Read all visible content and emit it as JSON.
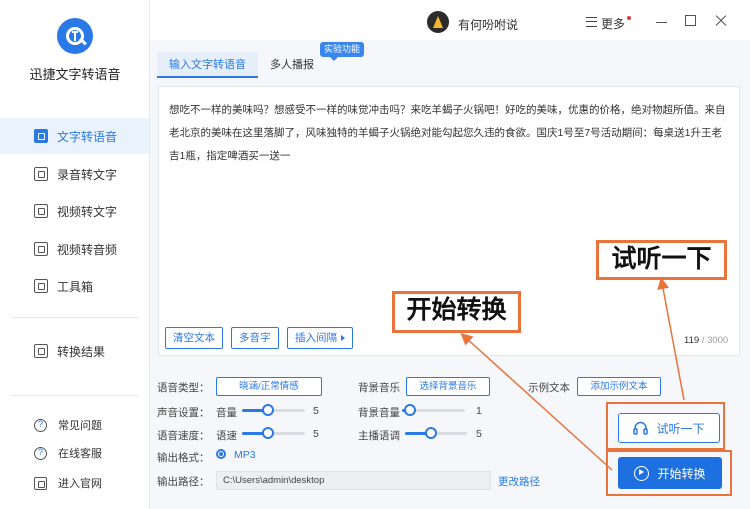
{
  "app": {
    "name": "迅捷文字转语音"
  },
  "sidebar": {
    "items": [
      {
        "label": "文字转语音",
        "active": true
      },
      {
        "label": "录音转文字"
      },
      {
        "label": "视频转文字"
      },
      {
        "label": "视频转音频"
      },
      {
        "label": "工具箱"
      }
    ],
    "result_label": "转换结果",
    "bottom": [
      {
        "label": "常见问题"
      },
      {
        "label": "在线客服"
      },
      {
        "label": "进入官网"
      }
    ]
  },
  "header": {
    "username": "有何吩咐说",
    "more_label": "更多"
  },
  "tabs": [
    {
      "label": "输入文字转语音",
      "active": true
    },
    {
      "label": "多人播报"
    }
  ],
  "badge": "实验功能",
  "editor": {
    "text": "想吃不一样的美味吗？想感受不一样的味觉冲击吗？来吃羊蝎子火锅吧！好吃的美味，优惠的价格，绝对物超所值。来自老北京的美味在这里落脚了，风味独特的羊蝎子火锅绝对能勾起您久违的食欲。国庆1号至7号活动期间：每桌送1升王老吉1瓶，指定啤酒买一送一",
    "count": "119",
    "max": "/ 3000",
    "buttons": {
      "clear": "清空文本",
      "polyphone": "多音字",
      "insert_pause": "插入间隔"
    }
  },
  "settings": {
    "voice_type_label": "语音类型：",
    "voice_type_value": "晓涵/正常情感",
    "bg_music_label": "背景音乐",
    "bg_music_button": "选择背景音乐",
    "sample_label": "示例文本",
    "sample_button": "添加示例文本",
    "sound_label": "声音设置：",
    "volume_label": "音量",
    "volume_value": "5",
    "bg_volume_label": "背景音量",
    "bg_volume_value": "1",
    "speed_label": "语音速度：",
    "speed_sub_label": "语速",
    "speed_value": "5",
    "tone_label": "主播语调",
    "tone_value": "5",
    "format_label": "输出格式：",
    "format_value": "MP3",
    "path_label": "输出路径：",
    "path_value": "C:\\Users\\admin\\desktop",
    "change_path": "更改路径"
  },
  "actions": {
    "listen": "试听一下",
    "convert": "开始转换"
  },
  "annotations": {
    "listen": "试听一下",
    "convert": "开始转换"
  },
  "colors": {
    "accent": "#2a79e6",
    "annotation": "#e8743b"
  }
}
